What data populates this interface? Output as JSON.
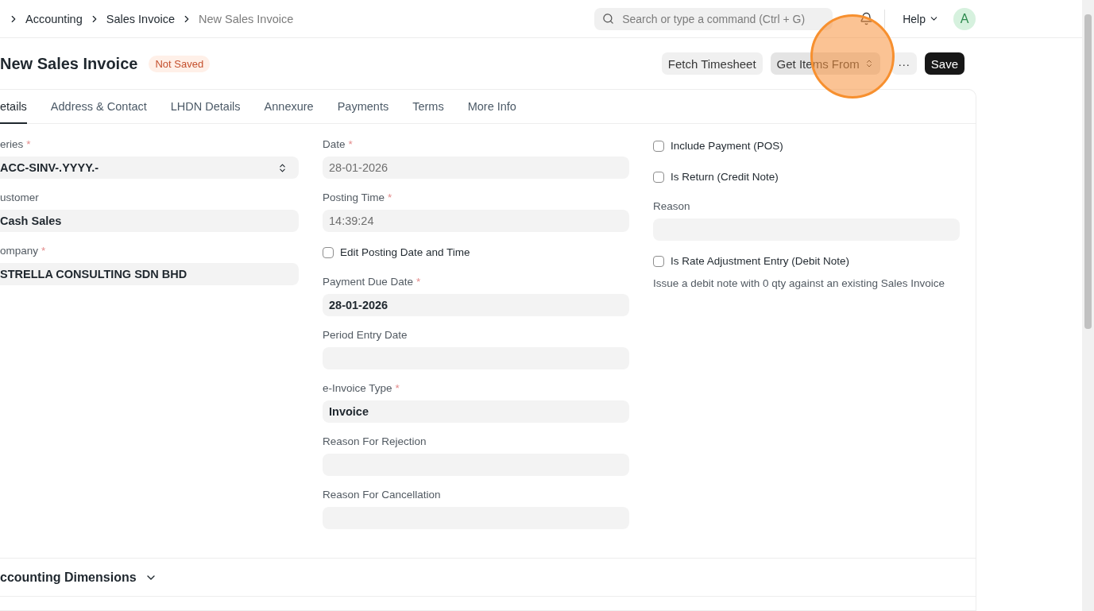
{
  "breadcrumbs": [
    {
      "label": "Accounting",
      "current": false
    },
    {
      "label": "Sales Invoice",
      "current": false
    },
    {
      "label": "New Sales Invoice",
      "current": true
    }
  ],
  "search": {
    "placeholder": "Search or type a command (Ctrl + G)"
  },
  "help": {
    "label": "Help"
  },
  "avatar": {
    "initial": "A"
  },
  "title": "New Sales Invoice",
  "status_badge": "Not Saved",
  "actions": [
    {
      "label": "Fetch Timesheet",
      "kind": "plain"
    },
    {
      "label": "Get Items From",
      "kind": "dropdown"
    },
    {
      "label": "···",
      "kind": "more"
    },
    {
      "label": "Save",
      "kind": "primary"
    }
  ],
  "tabs": [
    {
      "label": "etails",
      "selected": true
    },
    {
      "label": "Address & Contact",
      "selected": false
    },
    {
      "label": "LHDN Details",
      "selected": false
    },
    {
      "label": "Annexure",
      "selected": false
    },
    {
      "label": "Payments",
      "selected": false
    },
    {
      "label": "Terms",
      "selected": false
    },
    {
      "label": "More Info",
      "selected": false
    }
  ],
  "columns": [
    [
      {
        "kind": "select",
        "label": "eries",
        "required_mark": "*",
        "value": "ACC-SINV-.YYYY.-"
      },
      {
        "kind": "field",
        "label": "ustomer",
        "value": "Cash Sales"
      },
      {
        "kind": "field",
        "label": "ompany",
        "required_mark": "*",
        "value": "STRELLA CONSULTING SDN BHD"
      }
    ],
    [
      {
        "kind": "field",
        "label": "Date",
        "required_mark": "*",
        "value": "28-01-2026",
        "read_only": true
      },
      {
        "kind": "field",
        "label": "Posting Time",
        "required_mark": "*",
        "value": "14:39:24",
        "read_only": true
      },
      {
        "kind": "check",
        "label": "Edit Posting Date and Time",
        "checked": false
      },
      {
        "kind": "field",
        "label": "Payment Due Date",
        "required_mark": "*",
        "value": "28-01-2026"
      },
      {
        "kind": "field",
        "label": "Period Entry Date"
      },
      {
        "kind": "field",
        "label": "e-Invoice Type",
        "required_mark": "*",
        "value": "Invoice"
      },
      {
        "kind": "field",
        "label": "Reason For Rejection"
      },
      {
        "kind": "field",
        "label": "Reason For Cancellation"
      }
    ],
    [
      {
        "kind": "check",
        "label": "Include Payment (POS)",
        "checked": false
      },
      {
        "kind": "check",
        "label": "Is Return (Credit Note)",
        "checked": false
      },
      {
        "kind": "field",
        "label": "Reason"
      },
      {
        "kind": "check",
        "label": "Is Rate Adjustment Entry (Debit Note)",
        "checked": false,
        "description": "Issue a debit note with 0 qty against an existing Sales Invoice"
      }
    ]
  ],
  "section": {
    "label": "ccounting Dimensions",
    "expanded": false
  }
}
